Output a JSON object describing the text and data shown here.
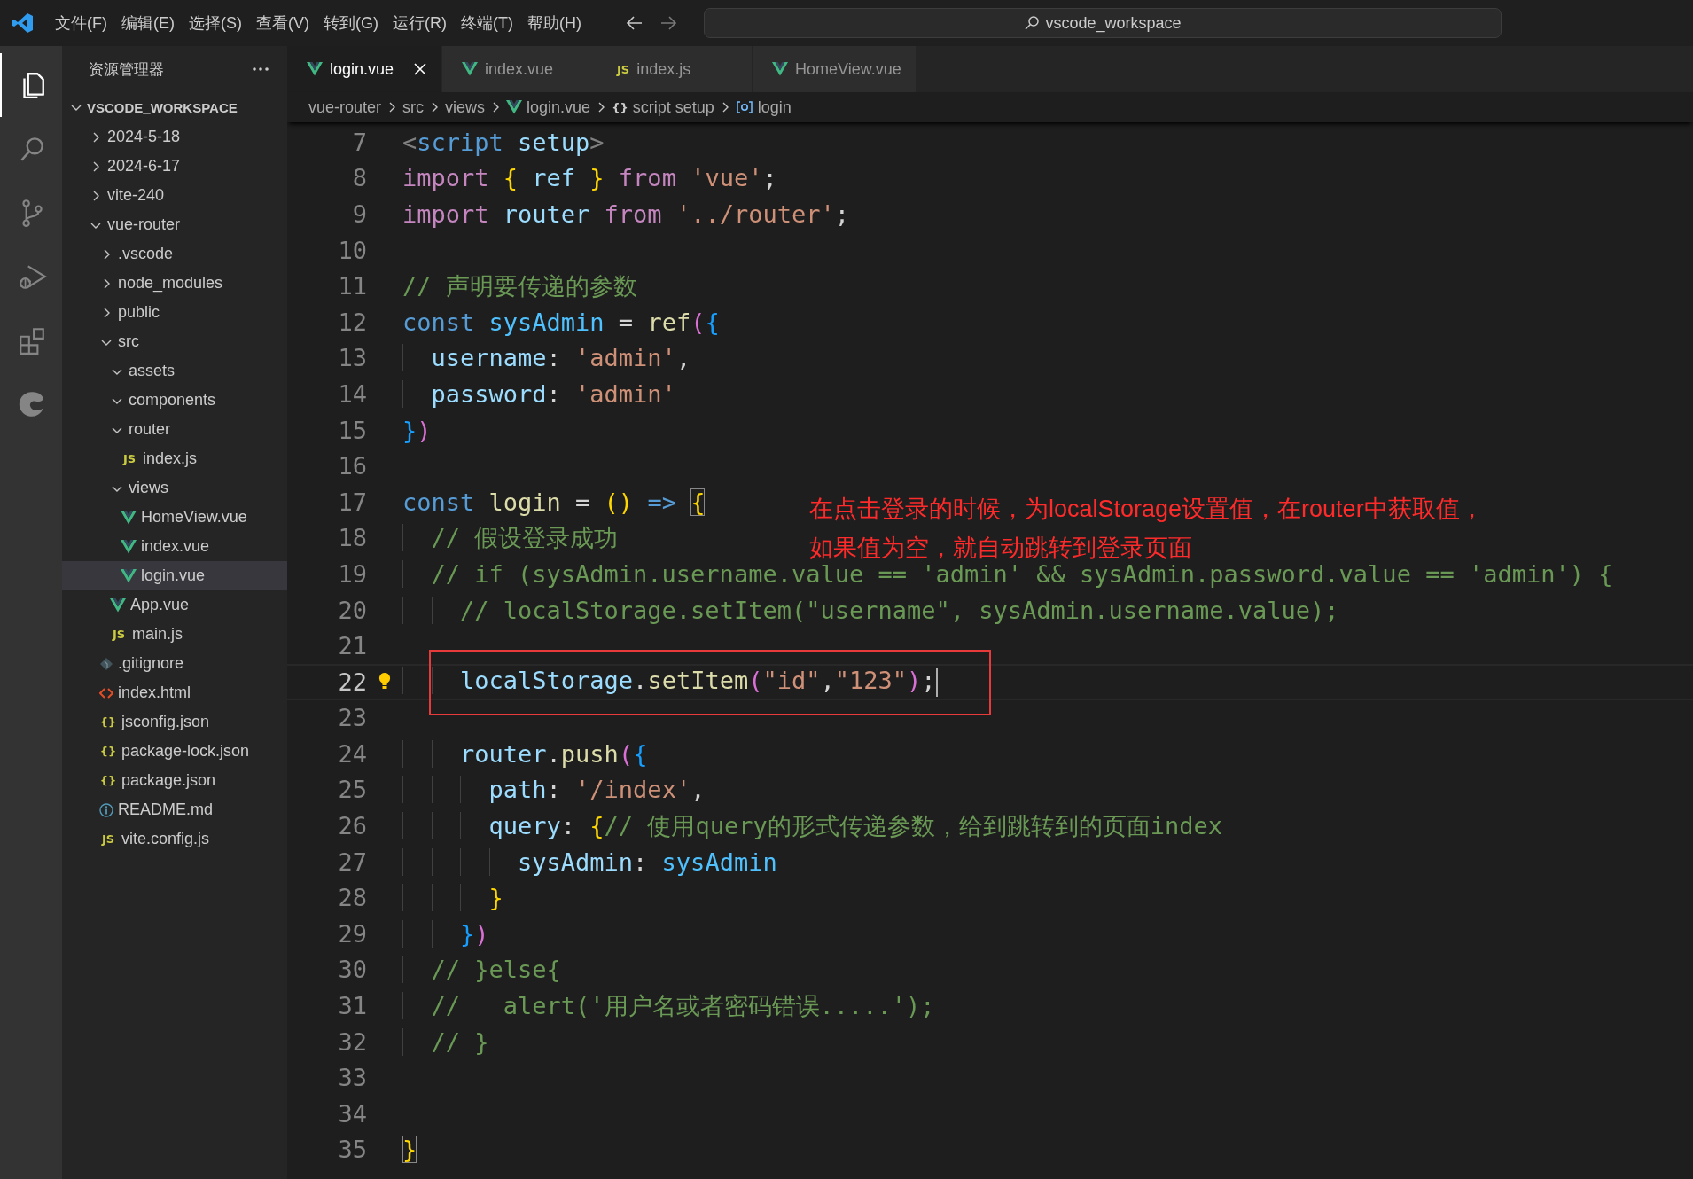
{
  "title_bar": {
    "menu": [
      "文件(F)",
      "编辑(E)",
      "选择(S)",
      "查看(V)",
      "转到(G)",
      "运行(R)",
      "终端(T)",
      "帮助(H)"
    ],
    "command_center": "vscode_workspace"
  },
  "activity_bar": [
    {
      "kind": "files",
      "selected": true
    },
    {
      "kind": "search",
      "selected": false
    },
    {
      "kind": "branch",
      "selected": false
    },
    {
      "kind": "debug",
      "selected": false
    },
    {
      "kind": "extensions",
      "selected": false
    },
    {
      "kind": "browser",
      "selected": false
    }
  ],
  "sidebar": {
    "title": "资源管理器",
    "section": {
      "label": "VSCODE_WORKSPACE",
      "expanded": true
    },
    "items": [
      {
        "label": "2024-5-18",
        "kind": "folder",
        "expanded": false,
        "selected": false
      },
      {
        "label": "2024-6-17",
        "kind": "folder",
        "expanded": false,
        "selected": false
      },
      {
        "label": "vite-240",
        "kind": "folder",
        "expanded": false,
        "selected": false
      },
      {
        "label": "vue-router",
        "kind": "folder",
        "expanded": true,
        "selected": false,
        "children": [
          {
            "label": ".vscode",
            "kind": "folder",
            "expanded": false,
            "selected": false
          },
          {
            "label": "node_modules",
            "kind": "folder",
            "expanded": false,
            "selected": false
          },
          {
            "label": "public",
            "kind": "folder",
            "expanded": false,
            "selected": false
          },
          {
            "label": "src",
            "kind": "folder",
            "expanded": true,
            "selected": false,
            "children": [
              {
                "label": "assets",
                "kind": "folder",
                "expanded": true,
                "selected": false
              },
              {
                "label": "components",
                "kind": "folder",
                "expanded": true,
                "selected": false
              },
              {
                "label": "router",
                "kind": "folder",
                "expanded": true,
                "selected": false,
                "children": [
                  {
                    "label": "index.js",
                    "kind": "js",
                    "glyph": "JS",
                    "selected": false
                  }
                ]
              },
              {
                "label": "views",
                "kind": "folder",
                "expanded": true,
                "selected": false,
                "children": [
                  {
                    "label": "HomeView.vue",
                    "kind": "vue",
                    "selected": false
                  },
                  {
                    "label": "index.vue",
                    "kind": "vue",
                    "selected": false
                  },
                  {
                    "label": "login.vue",
                    "kind": "vue",
                    "selected": true
                  }
                ]
              },
              {
                "label": "App.vue",
                "kind": "vue",
                "selected": false
              },
              {
                "label": "main.js",
                "kind": "js",
                "glyph": "JS",
                "selected": false
              }
            ]
          },
          {
            "label": ".gitignore",
            "kind": "git",
            "selected": false
          },
          {
            "label": "index.html",
            "kind": "html",
            "selected": false
          },
          {
            "label": "jsconfig.json",
            "kind": "json",
            "glyph": "{}",
            "selected": false
          },
          {
            "label": "package-lock.json",
            "kind": "json",
            "glyph": "{}",
            "selected": false
          },
          {
            "label": "package.json",
            "kind": "json",
            "glyph": "{}",
            "selected": false
          },
          {
            "label": "README.md",
            "kind": "info",
            "selected": false
          },
          {
            "label": "vite.config.js",
            "kind": "js",
            "glyph": "JS",
            "selected": false
          }
        ]
      }
    ]
  },
  "tabs": [
    {
      "label": "login.vue",
      "kind": "vue",
      "selected": true
    },
    {
      "label": "index.vue",
      "kind": "vue",
      "selected": false
    },
    {
      "label": "index.js",
      "kind": "js",
      "glyph": "JS",
      "selected": false
    },
    {
      "label": "HomeView.vue",
      "kind": "vue",
      "selected": false
    }
  ],
  "breadcrumbs": [
    {
      "label": "vue-router"
    },
    {
      "label": "src"
    },
    {
      "label": "views"
    },
    {
      "label": "login.vue",
      "kind": "vue"
    },
    {
      "label": "script setup",
      "kind": "braces",
      "glyph": "{}"
    },
    {
      "label": "login",
      "kind": "symbol"
    }
  ],
  "editor": {
    "lines": [
      {
        "number": "7",
        "tokens": [
          {
            "t": "<",
            "kind": "punct"
          },
          {
            "t": "script ",
            "kind": "tag"
          },
          {
            "t": "setup",
            "kind": "variable"
          },
          {
            "t": ">",
            "kind": "punct"
          }
        ]
      },
      {
        "number": "8",
        "tokens": [
          {
            "t": "import ",
            "kind": "keyword"
          },
          {
            "t": "{",
            "kind": "bracket1"
          },
          {
            "t": " ref ",
            "kind": "variable"
          },
          {
            "t": "} ",
            "kind": "bracket1"
          },
          {
            "t": "from ",
            "kind": "keyword"
          },
          {
            "t": "'vue'",
            "kind": "string"
          },
          {
            "t": ";"
          }
        ]
      },
      {
        "number": "9",
        "tokens": [
          {
            "t": "import ",
            "kind": "keyword"
          },
          {
            "t": "router ",
            "kind": "variable"
          },
          {
            "t": "from ",
            "kind": "keyword"
          },
          {
            "t": "'../router'",
            "kind": "string"
          },
          {
            "t": ";"
          }
        ]
      },
      {
        "number": "10"
      },
      {
        "number": "11",
        "tokens": [
          {
            "t": "// 声明要传递的参数",
            "kind": "comment"
          }
        ]
      },
      {
        "number": "12",
        "tokens": [
          {
            "t": "const ",
            "kind": "storage"
          },
          {
            "t": "sysAdmin",
            "kind": "constant"
          },
          {
            "t": " = "
          },
          {
            "t": "ref",
            "kind": "function"
          },
          {
            "t": "(",
            "kind": "bracket2"
          },
          {
            "t": "{",
            "kind": "bracket3"
          }
        ]
      },
      {
        "number": "13",
        "tokens": [
          {
            "t": "  username",
            "kind": "variable"
          },
          {
            "t": ": "
          },
          {
            "t": "'admin'",
            "kind": "string"
          },
          {
            "t": ","
          }
        ]
      },
      {
        "number": "14",
        "tokens": [
          {
            "t": "  password",
            "kind": "variable"
          },
          {
            "t": ": "
          },
          {
            "t": "'admin'",
            "kind": "string"
          }
        ]
      },
      {
        "number": "15",
        "tokens": [
          {
            "t": "}",
            "kind": "bracket3"
          },
          {
            "t": ")",
            "kind": "bracket2"
          }
        ]
      },
      {
        "number": "16"
      },
      {
        "number": "17",
        "tokens": [
          {
            "t": "const ",
            "kind": "storage"
          },
          {
            "t": "login",
            "kind": "function"
          },
          {
            "t": " = "
          },
          {
            "t": "() ",
            "kind": "bracket1"
          },
          {
            "t": "=> ",
            "kind": "storage"
          },
          {
            "t": "{",
            "kind": "bracket1",
            "matched": true
          }
        ]
      },
      {
        "number": "18",
        "tokens": [
          {
            "t": "  // 假设登录成功",
            "kind": "comment"
          }
        ]
      },
      {
        "number": "19",
        "tokens": [
          {
            "t": "  // if (sysAdmin.username.value == 'admin' && sysAdmin.password.value == 'admin') {",
            "kind": "comment"
          }
        ]
      },
      {
        "number": "20",
        "tokens": [
          {
            "t": "    // localStorage.setItem(\"username\", sysAdmin.username.value);",
            "kind": "comment"
          }
        ]
      },
      {
        "number": "21"
      },
      {
        "number": "22",
        "current": true,
        "outlined": true,
        "tokens": [
          {
            "t": "    localStorage",
            "kind": "variable"
          },
          {
            "t": "."
          },
          {
            "t": "setItem",
            "kind": "function"
          },
          {
            "t": "(",
            "kind": "bracket2"
          },
          {
            "t": "\"id\"",
            "kind": "string"
          },
          {
            "t": ","
          },
          {
            "t": "\"123\"",
            "kind": "string"
          },
          {
            "t": ")",
            "kind": "bracket2"
          },
          {
            "t": ";"
          }
        ]
      },
      {
        "number": "23"
      },
      {
        "number": "24",
        "tokens": [
          {
            "t": "    router",
            "kind": "variable"
          },
          {
            "t": "."
          },
          {
            "t": "push",
            "kind": "function"
          },
          {
            "t": "(",
            "kind": "bracket2"
          },
          {
            "t": "{",
            "kind": "bracket3"
          }
        ]
      },
      {
        "number": "25",
        "tokens": [
          {
            "t": "      path",
            "kind": "variable"
          },
          {
            "t": ": "
          },
          {
            "t": "'/index'",
            "kind": "string"
          },
          {
            "t": ","
          }
        ]
      },
      {
        "number": "26",
        "tokens": [
          {
            "t": "      query",
            "kind": "variable"
          },
          {
            "t": ": "
          },
          {
            "t": "{",
            "kind": "bracket1"
          },
          {
            "t": "// 使用query的形式传递参数，给到跳转到的页面index",
            "kind": "comment"
          }
        ]
      },
      {
        "number": "27",
        "tokens": [
          {
            "t": "        sysAdmin",
            "kind": "variable"
          },
          {
            "t": ": "
          },
          {
            "t": "sysAdmin",
            "kind": "constant"
          }
        ]
      },
      {
        "number": "28",
        "tokens": [
          {
            "t": "      }",
            "kind": "bracket1"
          }
        ]
      },
      {
        "number": "29",
        "tokens": [
          {
            "t": "    }",
            "kind": "bracket3"
          },
          {
            "t": ")",
            "kind": "bracket2"
          }
        ]
      },
      {
        "number": "30",
        "tokens": [
          {
            "t": "  // }else{",
            "kind": "comment"
          }
        ]
      },
      {
        "number": "31",
        "tokens": [
          {
            "t": "  //   alert('用户名或者密码错误.....');",
            "kind": "comment"
          }
        ]
      },
      {
        "number": "32",
        "tokens": [
          {
            "t": "  // }",
            "kind": "comment"
          }
        ]
      },
      {
        "number": "33"
      },
      {
        "number": "34"
      },
      {
        "number": "35",
        "tokens": [
          {
            "t": "}",
            "kind": "bracket1",
            "matched": true
          }
        ]
      }
    ],
    "annotation": [
      "在点击登录的时候，为localStorage设置值，在router中获取值，",
      "如果值为空，就自动跳转到登录页面"
    ]
  }
}
